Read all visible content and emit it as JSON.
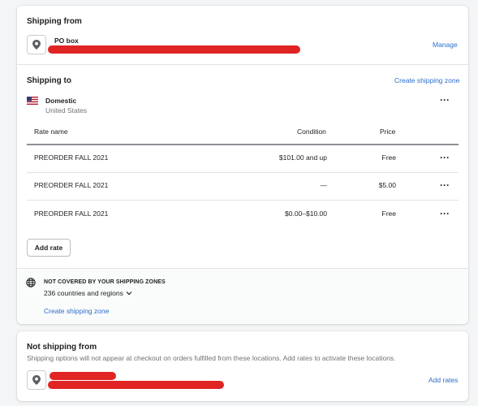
{
  "shipping_from": {
    "title": "Shipping from",
    "location_name": "PO box",
    "manage_label": "Manage"
  },
  "shipping_to": {
    "title": "Shipping to",
    "create_zone_label": "Create shipping zone",
    "zone": {
      "name": "Domestic",
      "country": "United States"
    },
    "table": {
      "headers": {
        "rate_name": "Rate name",
        "condition": "Condition",
        "price": "Price"
      },
      "sort_indicator": "▲",
      "rows": [
        {
          "name": "PREORDER FALL 2021",
          "condition": "$101.00 and up",
          "price": "Free"
        },
        {
          "name": "PREORDER FALL 2021",
          "condition": "—",
          "price": "$5.00"
        },
        {
          "name": "PREORDER FALL 2021",
          "condition": "$0.00–$10.00",
          "price": "Free"
        }
      ]
    },
    "add_rate_label": "Add rate"
  },
  "not_covered": {
    "title": "NOT COVERED BY YOUR SHIPPING ZONES",
    "count_label": "236 countries and regions",
    "create_zone_label": "Create shipping zone"
  },
  "not_shipping_from": {
    "title": "Not shipping from",
    "description": "Shipping options will not appear at checkout on orders fulfilled from these locations. Add rates to activate these locations.",
    "add_rates_label": "Add rates"
  },
  "icons": {
    "location": "location-pin-icon",
    "flag": "us-flag-icon",
    "globe": "globe-icon",
    "more": "more-horizontal-icon",
    "sort": "sort-ascending-icon",
    "chevron": "chevron-down-icon"
  },
  "colors": {
    "link": "#2c6ecb",
    "redaction": "#e02424",
    "background": "#f4f5f6"
  }
}
